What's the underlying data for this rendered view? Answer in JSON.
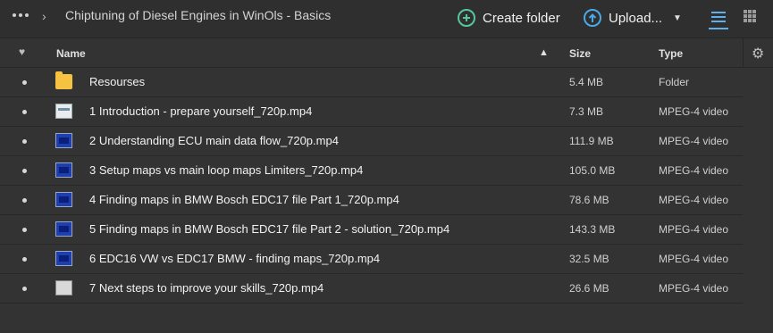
{
  "breadcrumb": {
    "title": "Chiptuning of Diesel Engines in WinOls - Basics"
  },
  "toolbar": {
    "create_folder_label": "Create folder",
    "upload_label": "Upload...",
    "accent_create": "#56c79c",
    "accent_upload": "#4aa9e8"
  },
  "table": {
    "headers": {
      "name": "Name",
      "size": "Size",
      "type": "Type"
    },
    "rows": [
      {
        "name": "Resourses",
        "size": "5.4 MB",
        "type": "Folder",
        "icon": "folder-icon"
      },
      {
        "name": "1 Introduction - prepare yourself_720p.mp4",
        "size": "7.3 MB",
        "type": "MPEG-4 video",
        "icon": "video-thumbnail-icon"
      },
      {
        "name": "2 Understanding ECU main data flow_720p.mp4",
        "size": "111.9 MB",
        "type": "MPEG-4 video",
        "icon": "video-thumbnail-icon"
      },
      {
        "name": "3 Setup maps vs main loop maps Limiters_720p.mp4",
        "size": "105.0 MB",
        "type": "MPEG-4 video",
        "icon": "video-thumbnail-icon"
      },
      {
        "name": "4 Finding maps in BMW Bosch EDC17 file Part 1_720p.mp4",
        "size": "78.6 MB",
        "type": "MPEG-4 video",
        "icon": "video-thumbnail-icon"
      },
      {
        "name": "5 Finding maps in BMW Bosch EDC17 file Part 2 - solution_720p.mp4",
        "size": "143.3 MB",
        "type": "MPEG-4 video",
        "icon": "video-thumbnail-icon"
      },
      {
        "name": "6 EDC16 VW vs EDC17 BMW - finding maps_720p.mp4",
        "size": "32.5 MB",
        "type": "MPEG-4 video",
        "icon": "video-thumbnail-icon"
      },
      {
        "name": "7 Next steps to improve your skills_720p.mp4",
        "size": "26.6 MB",
        "type": "MPEG-4 video",
        "icon": "video-thumbnail-icon"
      }
    ]
  }
}
